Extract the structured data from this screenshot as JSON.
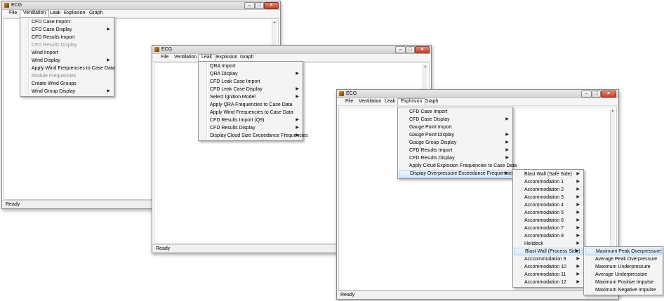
{
  "windows": [
    {
      "title": "ECG",
      "status": "Ready",
      "menubar": [
        "File",
        "Ventilation",
        "Leak",
        "Explosion",
        "Graph"
      ],
      "open_menu": "Ventilation",
      "menu_items": [
        {
          "label": "CFD Case Import",
          "submenu": false,
          "enabled": true
        },
        {
          "label": "CFD Case Display",
          "submenu": true,
          "enabled": true
        },
        {
          "label": "CFD Results Import",
          "submenu": false,
          "enabled": true
        },
        {
          "label": "CFD Results Display",
          "submenu": false,
          "enabled": false
        },
        {
          "label": "Wind Import",
          "submenu": false,
          "enabled": true
        },
        {
          "label": "Wind Display",
          "submenu": true,
          "enabled": true
        },
        {
          "label": "Apply Wind Frequencies to Case Data",
          "submenu": false,
          "enabled": true
        },
        {
          "label": "Module Frequencies",
          "submenu": false,
          "enabled": false
        },
        {
          "label": "Create Wind Groups",
          "submenu": false,
          "enabled": true
        },
        {
          "label": "Wind Group Display",
          "submenu": true,
          "enabled": true
        }
      ]
    },
    {
      "title": "ECG",
      "status": "Ready",
      "menubar": [
        "File",
        "Ventilation",
        "Leak",
        "Explosion",
        "Graph"
      ],
      "open_menu": "Leak",
      "menu_items": [
        {
          "label": "QRA Import",
          "submenu": false,
          "enabled": true
        },
        {
          "label": "QRA Display",
          "submenu": true,
          "enabled": true
        },
        {
          "label": "CFD Leak Case Import",
          "submenu": false,
          "enabled": true
        },
        {
          "label": "CFD Leak Case Display",
          "submenu": true,
          "enabled": true
        },
        {
          "label": "Select Ignition Model",
          "submenu": true,
          "enabled": true
        },
        {
          "label": "Apply QRA Frequencies to Case Data",
          "submenu": false,
          "enabled": true
        },
        {
          "label": "Apply Wind Frequencies to Case Data",
          "submenu": false,
          "enabled": true
        },
        {
          "label": "CFD Results Import (Q9)",
          "submenu": true,
          "enabled": true
        },
        {
          "label": "CFD Results Display",
          "submenu": true,
          "enabled": true
        },
        {
          "label": "Display Cloud Size Exceedance Frequencies",
          "submenu": true,
          "enabled": true
        }
      ]
    },
    {
      "title": "ECG",
      "status": "Ready",
      "menubar": [
        "File",
        "Ventilation",
        "Leak",
        "Explosion",
        "Graph"
      ],
      "open_menu": "Explosion",
      "menu_items": [
        {
          "label": "CFD Case Import",
          "submenu": false,
          "enabled": true
        },
        {
          "label": "CFD Case Display",
          "submenu": true,
          "enabled": true
        },
        {
          "label": "Gauge Point Import",
          "submenu": false,
          "enabled": true
        },
        {
          "label": "Gauge Point Display",
          "submenu": true,
          "enabled": true
        },
        {
          "label": "Gauge Group Display",
          "submenu": true,
          "enabled": true
        },
        {
          "label": "CFD Results Import",
          "submenu": true,
          "enabled": true
        },
        {
          "label": "CFD Results Display",
          "submenu": true,
          "enabled": true
        },
        {
          "label": "Apply Cloud Explosion Frequencies to Case Data",
          "submenu": false,
          "enabled": true
        },
        {
          "label": "Display Overpressure Exceedance Frequencies",
          "submenu": true,
          "enabled": true,
          "highlighted": true
        }
      ],
      "submenu_1": [
        {
          "label": "Blast Wall (Safe Side)",
          "submenu": true
        },
        {
          "label": "Accommodation 1",
          "submenu": true
        },
        {
          "label": "Accommodation 2",
          "submenu": true
        },
        {
          "label": "Accommodation 3",
          "submenu": true
        },
        {
          "label": "Accommodation 4",
          "submenu": true
        },
        {
          "label": "Accommodation 5",
          "submenu": true
        },
        {
          "label": "Accommodation 6",
          "submenu": true
        },
        {
          "label": "Accommodation 7",
          "submenu": true
        },
        {
          "label": "Accommodation 8",
          "submenu": true
        },
        {
          "label": "Helideck",
          "submenu": true
        },
        {
          "label": "Blast Wall (Process Side)",
          "submenu": true,
          "highlighted": true
        },
        {
          "label": "Acccommodation 9",
          "submenu": true
        },
        {
          "label": "Accommodation 10",
          "submenu": true
        },
        {
          "label": "Accommodation 11",
          "submenu": true
        },
        {
          "label": "Accommodation 12",
          "submenu": true
        }
      ],
      "submenu_2": [
        {
          "label": "Maximum Peak Overpressure",
          "highlighted": true
        },
        {
          "label": "Average Peak Overpressure"
        },
        {
          "label": "Maximum Underpressure"
        },
        {
          "label": "Average Underpressure"
        },
        {
          "label": "Maximum Positive Impulse"
        },
        {
          "label": "Maximum Negative Impulse"
        }
      ]
    }
  ],
  "icons": {
    "minimize": "minimize-icon",
    "maximize": "maximize-icon",
    "close": "close-icon",
    "submenu_arrow": "chevron-right-icon"
  },
  "colors": {
    "highlight_bg": "#d5e8fb",
    "highlight_border": "#a9cdf2",
    "close_button": "#c3432c"
  }
}
